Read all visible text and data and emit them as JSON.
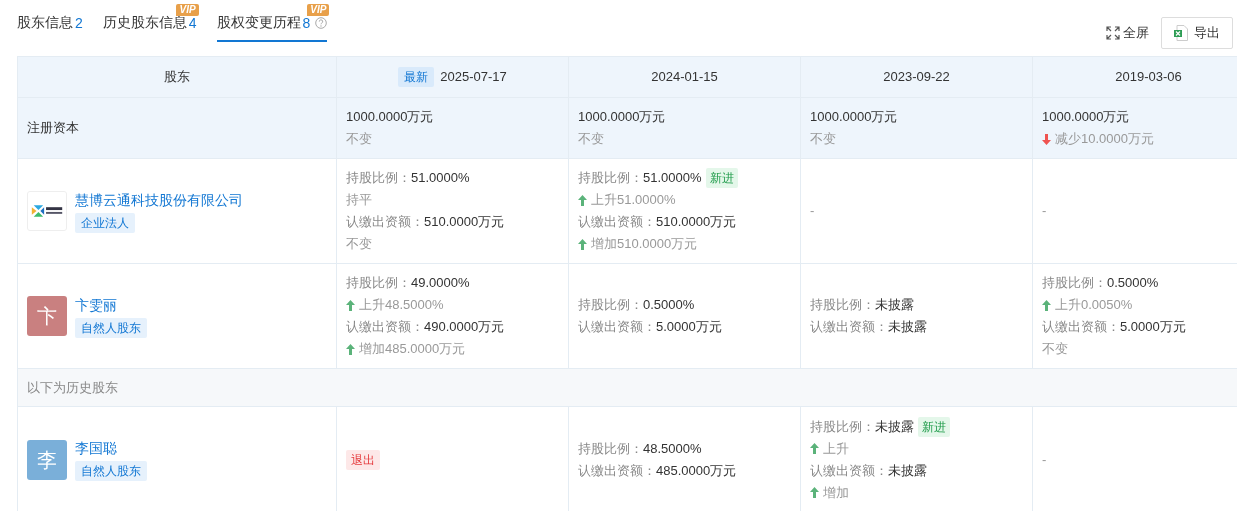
{
  "tabs": [
    {
      "label": "股东信息",
      "count": "2",
      "help": false,
      "selected": false
    },
    {
      "label": "历史股东信息",
      "count": "4",
      "vip": "VIP",
      "help": false,
      "selected": false
    },
    {
      "label": "股权变更历程",
      "count": "8",
      "vip": "VIP",
      "help": true,
      "selected": true
    }
  ],
  "actions": {
    "fullscreen": "全屏",
    "export": "导出"
  },
  "table": {
    "corner": "股东",
    "dates": [
      {
        "date": "2025-07-17",
        "badge": "最新"
      },
      {
        "date": "2024-01-15"
      },
      {
        "date": "2023-09-22"
      },
      {
        "date": "2019-03-06"
      }
    ],
    "capital": {
      "label": "注册资本",
      "cells": [
        {
          "value": "1000.0000万元",
          "change": {
            "kind": "flat",
            "text": "不变"
          }
        },
        {
          "value": "1000.0000万元",
          "change": {
            "kind": "flat",
            "text": "不变"
          }
        },
        {
          "value": "1000.0000万元",
          "change": {
            "kind": "flat",
            "text": "不变"
          }
        },
        {
          "value": "1000.0000万元",
          "change": {
            "kind": "fall",
            "text": "减少10.0000万元"
          }
        }
      ]
    },
    "rows": [
      {
        "kind": "holder",
        "avatar": {
          "kind": "logo"
        },
        "name": "慧博云通科技股份有限公司",
        "tag": "企业法人",
        "cells": [
          {
            "kind": "lines",
            "lines": [
              {
                "kind": "field",
                "label": "持股比例：",
                "value": "51.0000%"
              },
              {
                "kind": "flat",
                "text": "持平"
              },
              {
                "kind": "field",
                "label": "认缴出资额：",
                "value": "510.0000万元"
              },
              {
                "kind": "flat",
                "text": "不变"
              }
            ]
          },
          {
            "kind": "lines",
            "lines": [
              {
                "kind": "field",
                "label": "持股比例：",
                "value": "51.0000%",
                "badge": "新进"
              },
              {
                "kind": "rise",
                "text": "上升51.0000%"
              },
              {
                "kind": "field",
                "label": "认缴出资额：",
                "value": "510.0000万元"
              },
              {
                "kind": "rise",
                "text": "增加510.0000万元"
              }
            ]
          },
          {
            "kind": "dash",
            "text": "-"
          },
          {
            "kind": "dash",
            "text": "-"
          }
        ]
      },
      {
        "kind": "holder",
        "avatar": {
          "kind": "letter",
          "text": "卞",
          "color": "#c98080"
        },
        "name": "卞雯丽",
        "tag": "自然人股东",
        "cells": [
          {
            "kind": "lines",
            "lines": [
              {
                "kind": "field",
                "label": "持股比例：",
                "value": "49.0000%"
              },
              {
                "kind": "rise",
                "text": "上升48.5000%"
              },
              {
                "kind": "field",
                "label": "认缴出资额：",
                "value": "490.0000万元"
              },
              {
                "kind": "rise",
                "text": "增加485.0000万元"
              }
            ]
          },
          {
            "kind": "lines",
            "lines": [
              {
                "kind": "field",
                "label": "持股比例：",
                "value": "0.5000%"
              },
              {
                "kind": "field",
                "label": "认缴出资额：",
                "value": "5.0000万元"
              }
            ]
          },
          {
            "kind": "lines",
            "lines": [
              {
                "kind": "field",
                "label": "持股比例：",
                "value": "未披露"
              },
              {
                "kind": "field",
                "label": "认缴出资额：",
                "value": "未披露"
              }
            ]
          },
          {
            "kind": "lines",
            "lines": [
              {
                "kind": "field",
                "label": "持股比例：",
                "value": "0.5000%"
              },
              {
                "kind": "rise",
                "text": "上升0.0050%"
              },
              {
                "kind": "field",
                "label": "认缴出资额：",
                "value": "5.0000万元"
              },
              {
                "kind": "flat",
                "text": "不变"
              }
            ]
          }
        ]
      },
      {
        "kind": "section",
        "text": "以下为历史股东"
      },
      {
        "kind": "holder",
        "avatar": {
          "kind": "letter",
          "text": "李",
          "color": "#7aafd9"
        },
        "name": "李国聪",
        "tag": "自然人股东",
        "cells": [
          {
            "kind": "exit",
            "text": "退出"
          },
          {
            "kind": "lines",
            "lines": [
              {
                "kind": "field",
                "label": "持股比例：",
                "value": "48.5000%"
              },
              {
                "kind": "field",
                "label": "认缴出资额：",
                "value": "485.0000万元"
              }
            ]
          },
          {
            "kind": "lines",
            "lines": [
              {
                "kind": "field",
                "label": "持股比例：",
                "value": "未披露",
                "badge": "新进"
              },
              {
                "kind": "rise",
                "text": "上升"
              },
              {
                "kind": "field",
                "label": "认缴出资额：",
                "value": "未披露"
              },
              {
                "kind": "rise",
                "text": "增加"
              }
            ]
          },
          {
            "kind": "dash",
            "text": "-"
          }
        ]
      }
    ]
  }
}
